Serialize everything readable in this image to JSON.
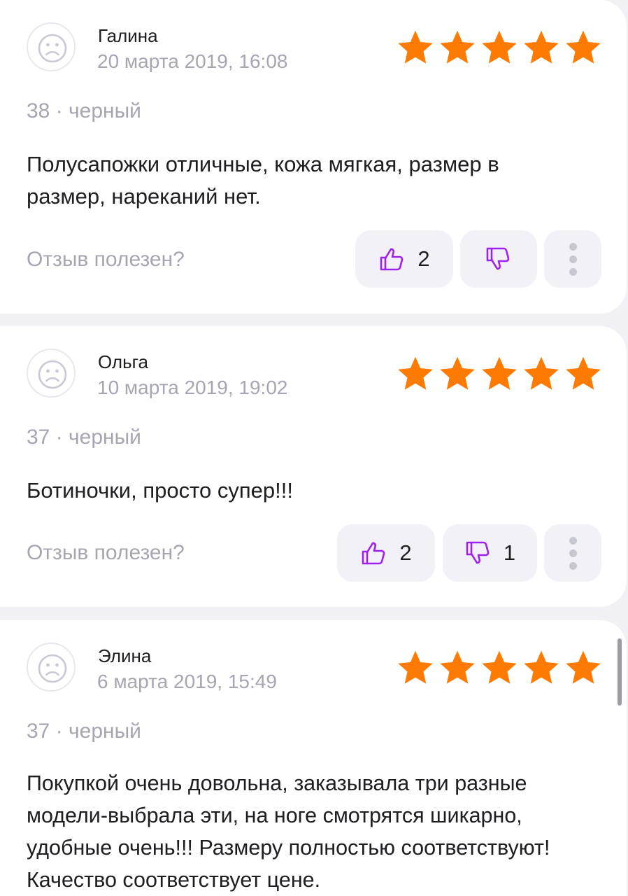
{
  "colors": {
    "star": "#ff7a00",
    "vote_icon": "#a020f0",
    "muted_text": "#a6a6b3",
    "card_bg": "#ffffff",
    "page_bg": "#f0f0f5"
  },
  "helpful_label": "Отзыв полезен?",
  "reviews": [
    {
      "author": "Галина",
      "date": "20 марта 2019, 16:08",
      "rating": 5,
      "variant": "38 · черный",
      "text": "Полусапожки отличные, кожа мягкая, размер в размер, нареканий нет.",
      "likes": "2",
      "dislikes": ""
    },
    {
      "author": "Ольга",
      "date": "10 марта 2019, 19:02",
      "rating": 5,
      "variant": "37 · черный",
      "text": "Ботиночки, просто супер!!!",
      "likes": "2",
      "dislikes": "1"
    },
    {
      "author": "Элина",
      "date": "6 марта 2019, 15:49",
      "rating": 5,
      "variant": "37 · черный",
      "text": "Покупкой очень довольна, заказывала три разные модели-выбрала эти, на ноге смотрятся шикарно, удобные очень!!! Размеру полностью соответствуют! Качество соответствует цене.",
      "likes": "",
      "dislikes": ""
    }
  ]
}
